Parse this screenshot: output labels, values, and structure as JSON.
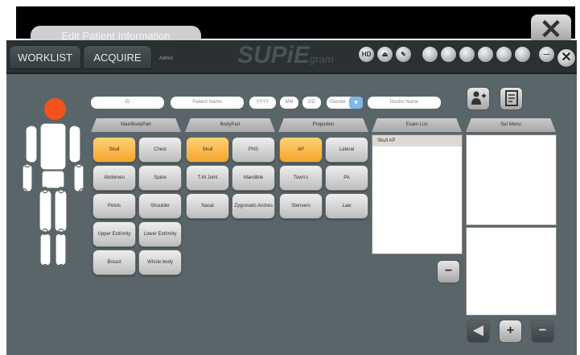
{
  "ghost_tab": "Edit Patient Information",
  "close_top": "✕",
  "tabs": [
    {
      "label": "WORKLIST"
    },
    {
      "label": "ACQUIRE"
    }
  ],
  "admin_label": "Admin",
  "logo": "SUPiE",
  "logo_sub": "gram",
  "toolbar_icons": [
    {
      "name": "hd-icon",
      "label": "HD"
    },
    {
      "name": "eject-icon",
      "label": "⏏"
    },
    {
      "name": "pencil-icon",
      "label": "✎"
    },
    {
      "name": "image-icon",
      "label": ""
    },
    {
      "name": "dose-icon",
      "label": ""
    },
    {
      "name": "list-icon",
      "label": ""
    },
    {
      "name": "print-icon",
      "label": ""
    },
    {
      "name": "storage-icon",
      "label": ""
    },
    {
      "name": "settings-icon",
      "label": ""
    },
    {
      "name": "minimize-icon",
      "label": "—"
    }
  ],
  "close_win": "✕",
  "form": {
    "id_placeholder": "ID",
    "name_placeholder": "Patient Name",
    "yyyy": "YYYY",
    "mm": "MM",
    "dd": "DD",
    "gender": "Gender",
    "doctor_placeholder": "Doctor Name"
  },
  "columns": {
    "main_body_part": "MainBodyPart",
    "body_part": "BodyPart",
    "projection": "Projection",
    "exam_list": "Exam List",
    "set_menu": "Set Menu"
  },
  "main_body_parts": [
    {
      "label": "Skull",
      "selected": true
    },
    {
      "label": "Chest",
      "selected": false
    },
    {
      "label": "Abdomen",
      "selected": false
    },
    {
      "label": "Spine",
      "selected": false
    },
    {
      "label": "Pelvis",
      "selected": false
    },
    {
      "label": "Shoulder",
      "selected": false
    },
    {
      "label": "Upper Extrimity",
      "selected": false
    },
    {
      "label": "Lower Extrimity",
      "selected": false
    },
    {
      "label": "Breast",
      "selected": false
    },
    {
      "label": "Whole body",
      "selected": false
    }
  ],
  "body_parts": [
    {
      "label": "Skull",
      "selected": true
    },
    {
      "label": "PNS",
      "selected": false
    },
    {
      "label": "T-M Joint",
      "selected": false
    },
    {
      "label": "Mandible",
      "selected": false
    },
    {
      "label": "Nasal",
      "selected": false
    },
    {
      "label": "Zygomatic Arches",
      "selected": false
    }
  ],
  "projections": [
    {
      "label": "AP",
      "selected": true
    },
    {
      "label": "Lateral",
      "selected": false
    },
    {
      "label": "Town's",
      "selected": false
    },
    {
      "label": "PA",
      "selected": false
    },
    {
      "label": "Stenvers",
      "selected": false
    },
    {
      "label": "Law",
      "selected": false
    }
  ],
  "exam_list": [
    "Skull AP"
  ],
  "buttons": {
    "remove": "−",
    "back": "◀",
    "add": "+",
    "minus": "−"
  },
  "colors": {
    "selected": "#f4a52b",
    "background": "#5a6569",
    "head": "#f4511e"
  }
}
